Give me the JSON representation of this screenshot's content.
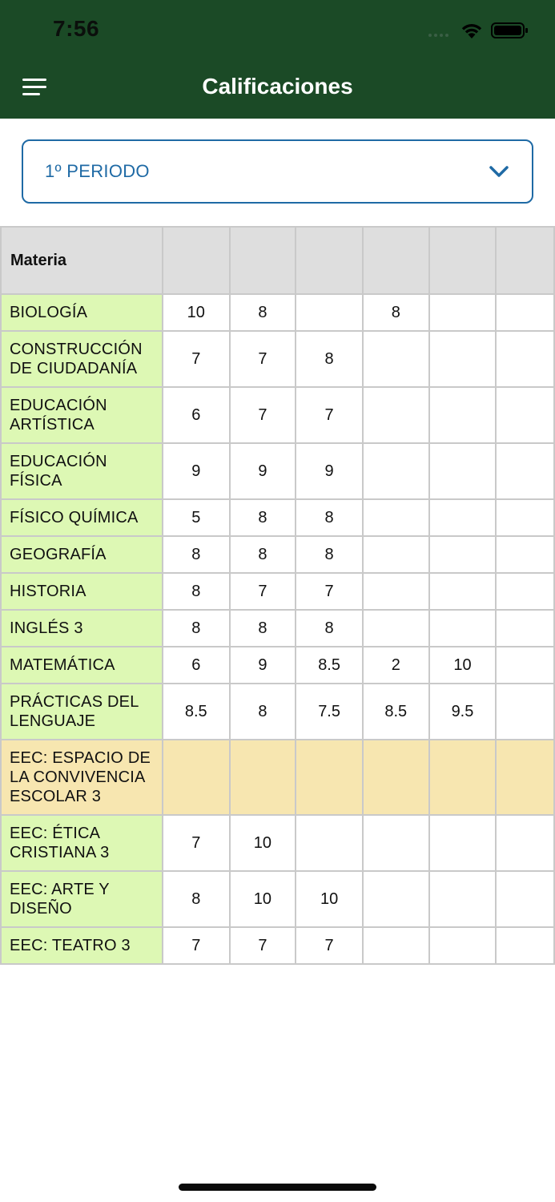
{
  "status_bar": {
    "time": "7:56"
  },
  "header": {
    "title": "Calificaciones",
    "menu_icon": "hamburger-menu-icon"
  },
  "period_select": {
    "value": "1º PERIODO",
    "icon": "chevron-down-icon"
  },
  "table": {
    "header_subject": "Materia",
    "columns": [
      "",
      "",
      "",
      "",
      "",
      ""
    ],
    "rows": [
      {
        "subject": "BIOLOGÍA",
        "grades": [
          "10",
          "8",
          "",
          "8",
          "",
          ""
        ]
      },
      {
        "subject": "CONSTRUCCIÓN DE CIUDADANÍA",
        "grades": [
          "7",
          "7",
          "8",
          "",
          "",
          ""
        ]
      },
      {
        "subject": "EDUCACIÓN ARTÍSTICA",
        "grades": [
          "6",
          "7",
          "7",
          "",
          "",
          ""
        ]
      },
      {
        "subject": "EDUCACIÓN FÍSICA",
        "grades": [
          "9",
          "9",
          "9",
          "",
          "",
          ""
        ]
      },
      {
        "subject": "FÍSICO QUÍMICA",
        "grades": [
          "5",
          "8",
          "8",
          "",
          "",
          ""
        ]
      },
      {
        "subject": "GEOGRAFÍA",
        "grades": [
          "8",
          "8",
          "8",
          "",
          "",
          ""
        ]
      },
      {
        "subject": "HISTORIA",
        "grades": [
          "8",
          "7",
          "7",
          "",
          "",
          ""
        ]
      },
      {
        "subject": "INGLÉS 3",
        "grades": [
          "8",
          "8",
          "8",
          "",
          "",
          ""
        ]
      },
      {
        "subject": "MATEMÁTICA",
        "grades": [
          "6",
          "9",
          "8.5",
          "2",
          "10",
          ""
        ]
      },
      {
        "subject": "PRÁCTICAS DEL LENGUAJE",
        "grades": [
          "8.5",
          "8",
          "7.5",
          "8.5",
          "9.5",
          ""
        ]
      },
      {
        "subject": "EEC: ESPACIO DE LA CONVIVENCIA ESCOLAR 3",
        "grades": [
          "",
          "",
          "",
          "",
          "",
          ""
        ]
      },
      {
        "subject": "EEC: ÉTICA CRISTIANA 3",
        "grades": [
          "7",
          "10",
          "",
          "",
          "",
          ""
        ]
      },
      {
        "subject": "EEC: ARTE Y DISEÑO",
        "grades": [
          "8",
          "10",
          "10",
          "",
          "",
          ""
        ]
      },
      {
        "subject": "EEC: TEATRO 3",
        "grades": [
          "7",
          "7",
          "7",
          "",
          "",
          ""
        ]
      }
    ]
  },
  "colors": {
    "header_bg": "#1b4a26",
    "accent": "#1f6aa5",
    "subject_bg": "#ddf8b4",
    "special_row_bg": "#f7e6b0",
    "table_header_bg": "#dedede"
  }
}
